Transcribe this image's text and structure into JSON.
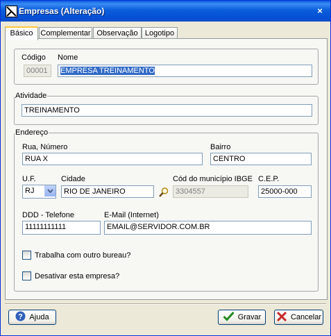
{
  "window": {
    "title": "Empresas (Alteração)",
    "close_label": "×"
  },
  "tabs": [
    {
      "label": "Básico"
    },
    {
      "label": "Complementar"
    },
    {
      "label": "Observação"
    },
    {
      "label": "Logotipo"
    }
  ],
  "form": {
    "codigo_label": "Código",
    "codigo_value": "00001",
    "nome_label": "Nome",
    "nome_value": "EMPRESA TREINAMENTO",
    "atividade_title": "Atividade",
    "atividade_value": "TREINAMENTO",
    "endereco_title": "Endereço",
    "rua_label": "Rua, Número",
    "rua_value": "RUA X",
    "bairro_label": "Bairro",
    "bairro_value": "CENTRO",
    "uf_label": "U.F.",
    "uf_value": "RJ",
    "cidade_label": "Cidade",
    "cidade_value": "RIO DE JANEIRO",
    "ibge_label": "Cód do município IBGE",
    "ibge_value": "3304557",
    "cep_label": "C.E.P.",
    "cep_value": "25000-000",
    "telefone_label": "DDD - Telefone",
    "telefone_value": "11111111111",
    "email_label": "E-Mail (Internet)",
    "email_value": "EMAIL@SERVIDOR.COM.BR",
    "bureau_label": "Trabalha com outro bureau?",
    "desativar_label": "Desativar esta empresa?"
  },
  "buttons": {
    "help": "Ajuda",
    "save": "Gravar",
    "cancel": "Cancelar"
  },
  "colors": {
    "title_bar": "#0A5CDD",
    "selection": "#316AC5"
  }
}
